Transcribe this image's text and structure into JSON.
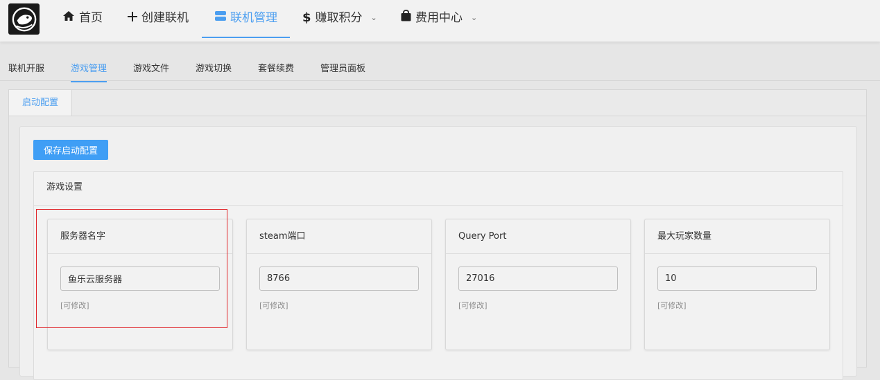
{
  "nav": {
    "home": "首页",
    "create": "创建联机",
    "manage": "联机管理",
    "earn": "赚取积分",
    "billing": "费用中心"
  },
  "subtabs": [
    "联机开服",
    "游戏管理",
    "游戏文件",
    "游戏切换",
    "套餐续费",
    "管理员面板"
  ],
  "panel": {
    "tab": "启动配置",
    "save_button": "保存启动配置",
    "section_title": "游戏设置"
  },
  "fields": [
    {
      "label": "服务器名字",
      "value": "鱼乐云服务器",
      "note": "[可修改]"
    },
    {
      "label": "steam端口",
      "value": "8766",
      "note": "[可修改]"
    },
    {
      "label": "Query Port",
      "value": "27016",
      "note": "[可修改]"
    },
    {
      "label": "最大玩家数量",
      "value": "10",
      "note": "[可修改]"
    }
  ],
  "colors": {
    "accent": "#4b9ef0",
    "button": "#3f9ef5",
    "highlight": "#e0262b"
  }
}
